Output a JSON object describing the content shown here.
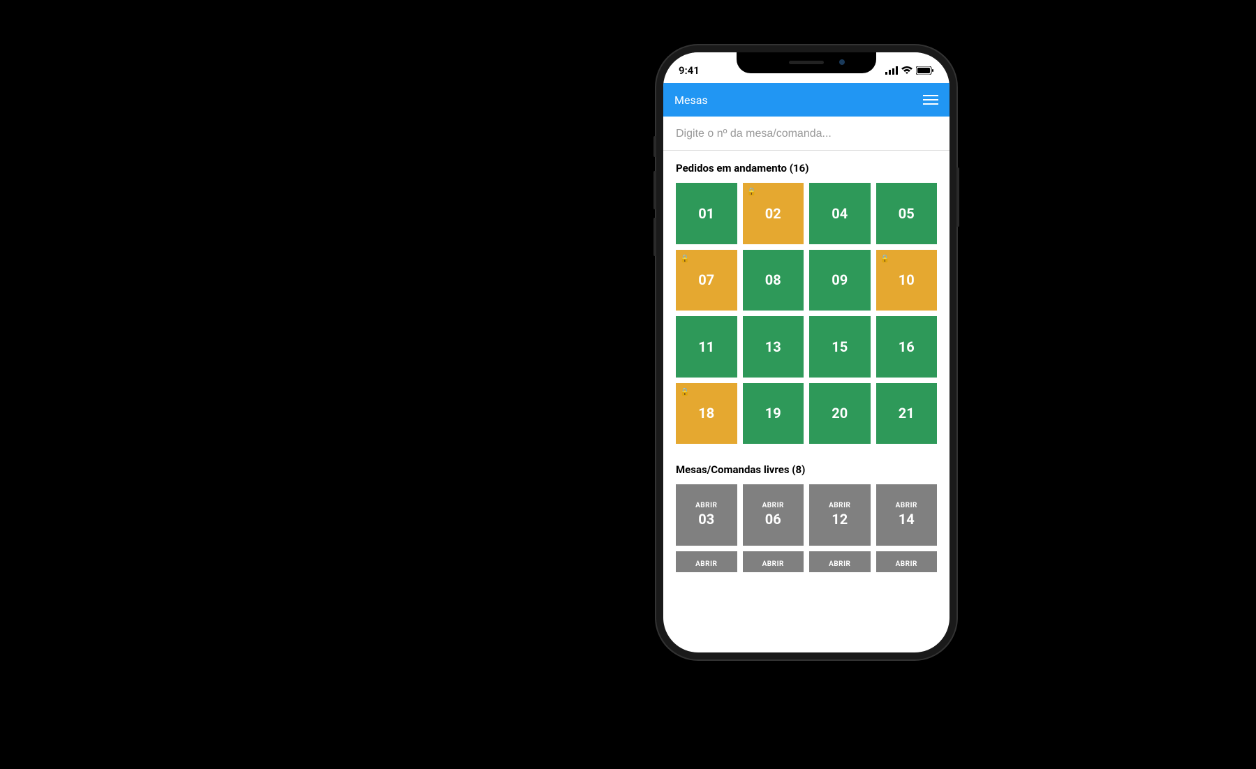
{
  "status_bar": {
    "time": "9:41"
  },
  "header": {
    "title": "Mesas"
  },
  "search": {
    "placeholder": "Digite o nº da mesa/comanda..."
  },
  "sections": {
    "in_progress": {
      "title": "Pedidos em andamento (16)",
      "count": 16,
      "tiles": [
        {
          "number": "01",
          "color": "green",
          "locked": false
        },
        {
          "number": "02",
          "color": "yellow",
          "locked": true
        },
        {
          "number": "04",
          "color": "green",
          "locked": false
        },
        {
          "number": "05",
          "color": "green",
          "locked": false
        },
        {
          "number": "07",
          "color": "yellow",
          "locked": true
        },
        {
          "number": "08",
          "color": "green",
          "locked": false
        },
        {
          "number": "09",
          "color": "green",
          "locked": false
        },
        {
          "number": "10",
          "color": "yellow",
          "locked": true
        },
        {
          "number": "11",
          "color": "green",
          "locked": false
        },
        {
          "number": "13",
          "color": "green",
          "locked": false
        },
        {
          "number": "15",
          "color": "green",
          "locked": false
        },
        {
          "number": "16",
          "color": "green",
          "locked": false
        },
        {
          "number": "18",
          "color": "yellow",
          "locked": true
        },
        {
          "number": "19",
          "color": "green",
          "locked": false
        },
        {
          "number": "20",
          "color": "green",
          "locked": false
        },
        {
          "number": "21",
          "color": "green",
          "locked": false
        }
      ]
    },
    "free": {
      "title": "Mesas/Comandas livres (8)",
      "count": 8,
      "open_label": "ABRIR",
      "tiles": [
        {
          "number": "03"
        },
        {
          "number": "06"
        },
        {
          "number": "12"
        },
        {
          "number": "14"
        }
      ],
      "tiles_row2_partial": [
        {
          "open_label": "ABRIR"
        },
        {
          "open_label": "ABRIR"
        },
        {
          "open_label": "ABRIR"
        },
        {
          "open_label": "ABRIR"
        }
      ]
    }
  }
}
